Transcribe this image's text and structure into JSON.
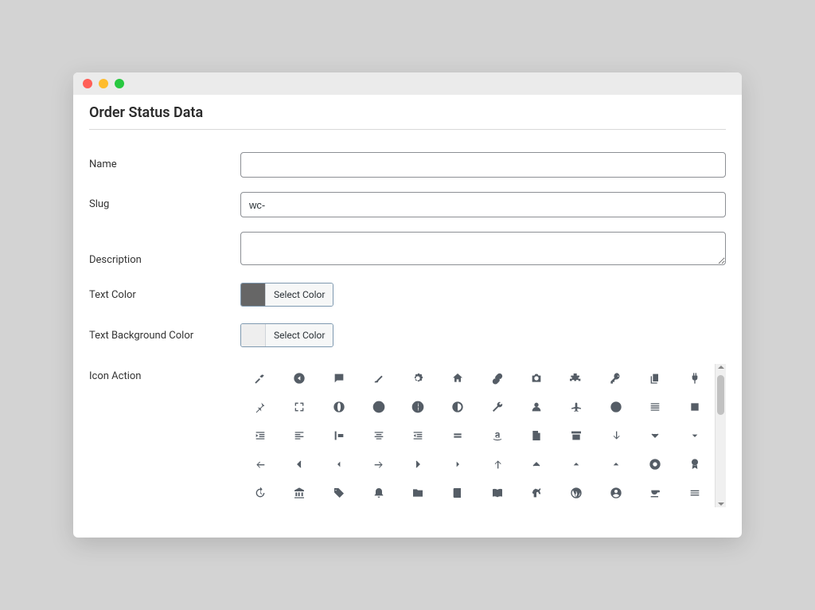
{
  "window": {
    "title": "Order Status Data"
  },
  "form": {
    "name": {
      "label": "Name",
      "value": ""
    },
    "slug": {
      "label": "Slug",
      "value": "wc-"
    },
    "description": {
      "label": "Description",
      "value": ""
    },
    "text_color": {
      "label": "Text Color",
      "button": "Select Color",
      "swatch": "#666666"
    },
    "text_bg_color": {
      "label": "Text Background Color",
      "button": "Select Color",
      "swatch": "#eeeeee"
    },
    "icon_action": {
      "label": "Icon Action",
      "icons": [
        "hammer",
        "circle-left",
        "comment",
        "brush",
        "gear",
        "home",
        "link",
        "camera",
        "sitemap",
        "key",
        "copy",
        "plug",
        "pin",
        "expand",
        "globe-solid",
        "globe-alt",
        "globe-grid",
        "globe",
        "wrench",
        "user",
        "plane",
        "contrast",
        "align-justify",
        "square",
        "indent",
        "align-left",
        "align-start",
        "align-center",
        "outdent",
        "equals",
        "amazon",
        "page",
        "archive",
        "arrow-down",
        "chevron-down",
        "caret-down",
        "arrow-left",
        "chevron-left",
        "caret-left",
        "arrow-right",
        "chevron-right",
        "caret-right",
        "arrow-up",
        "chevron-up",
        "caret-up",
        "caret-up-alt",
        "disc",
        "award",
        "history",
        "institution",
        "tag",
        "bell",
        "folder",
        "book",
        "book-open",
        "horse",
        "wordpress",
        "user-circle",
        "coffee",
        "burger"
      ]
    }
  }
}
